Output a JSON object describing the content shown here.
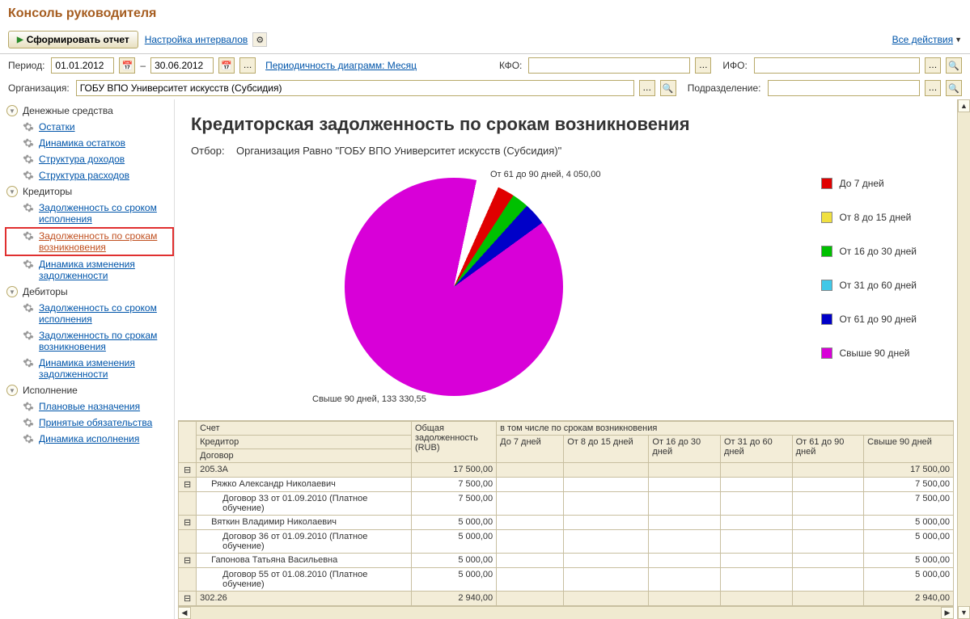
{
  "window_title": "Консоль руководителя",
  "toolbar": {
    "form_report": "Сформировать отчет",
    "interval_settings": "Настройка интервалов",
    "all_actions": "Все действия"
  },
  "filters": {
    "period_label": "Период:",
    "date_from": "01.01.2012",
    "date_to": "30.06.2012",
    "periodicity_link": "Периодичность диаграмм: Месяц",
    "kfo_label": "КФО:",
    "kfo_value": "",
    "ifo_label": "ИФО:",
    "ifo_value": "",
    "org_label": "Организация:",
    "org_value": "ГОБУ ВПО Университет искусств (Субсидия)",
    "dept_label": "Подразделение:",
    "dept_value": ""
  },
  "sidebar": {
    "sections": [
      {
        "title": "Денежные средства",
        "items": [
          "Остатки",
          "Динамика остатков",
          "Структура доходов",
          "Структура расходов"
        ]
      },
      {
        "title": "Кредиторы",
        "items": [
          "Задолженность со сроком исполнения",
          "Задолженность по срокам возникновения",
          "Динамика изменения задолженности"
        ],
        "active_index": 1
      },
      {
        "title": "Дебиторы",
        "items": [
          "Задолженность со сроком исполнения",
          "Задолженность по срокам возникновения",
          "Динамика изменения задолженности"
        ]
      },
      {
        "title": "Исполнение",
        "items": [
          "Плановые назначения",
          "Принятые обязательства",
          "Динамика исполнения"
        ]
      }
    ]
  },
  "report": {
    "title": "Кредиторская задолженность по срокам возникновения",
    "filter_label": "Отбор:",
    "filter_text": "Организация Равно \"ГОБУ ВПО Университет искусств (Субсидия)\"",
    "chart_label_1": "От 61 до 90 дней, 4 050,00",
    "chart_label_2": "Свыше 90 дней, 133 330,55"
  },
  "legend": {
    "items": [
      {
        "label": "До 7 дней",
        "color": "#e00000"
      },
      {
        "label": "От 8 до 15 дней",
        "color": "#f0e040"
      },
      {
        "label": "От 16 до 30 дней",
        "color": "#00c000"
      },
      {
        "label": "От 31 до 60 дней",
        "color": "#40c8e8"
      },
      {
        "label": "От 61 до 90 дней",
        "color": "#0000c8"
      },
      {
        "label": "Свыше 90 дней",
        "color": "#d800d8"
      }
    ]
  },
  "chart_data": {
    "type": "pie",
    "title": "Кредиторская задолженность по срокам возникновения",
    "series": [
      {
        "name": "До 7 дней",
        "value": 2000
      },
      {
        "name": "От 8 до 15 дней",
        "value": 0
      },
      {
        "name": "От 16 до 30 дней",
        "value": 2000
      },
      {
        "name": "От 31 до 60 дней",
        "value": 0
      },
      {
        "name": "От 61 до 90 дней",
        "value": 4050.0
      },
      {
        "name": "Свыше 90 дней",
        "value": 133330.55
      }
    ]
  },
  "table": {
    "headers": {
      "col1_a": "Счет",
      "col1_b": "Кредитор",
      "col1_c": "Договор",
      "col2": "Общая задолженность (RUB)",
      "group": "в том числе по срокам возникновения",
      "sub": [
        "До 7 дней",
        "От 8 до 15 дней",
        "От 16 до 30 дней",
        "От 31 до 60 дней",
        "От 61 до 90 дней",
        "Свыше 90 дней"
      ]
    },
    "rows": [
      {
        "level": 0,
        "name": "205.3А",
        "total": "17 500,00",
        "over90": "17 500,00"
      },
      {
        "level": 1,
        "name": "Ряжко Александр Николаевич",
        "total": "7 500,00",
        "over90": "7 500,00"
      },
      {
        "level": 2,
        "name": "Договор 33 от 01.09.2010 (Платное обучение)",
        "total": "7 500,00",
        "over90": "7 500,00"
      },
      {
        "level": 1,
        "name": "Вяткин Владимир Николаевич",
        "total": "5 000,00",
        "over90": "5 000,00"
      },
      {
        "level": 2,
        "name": "Договор 36 от 01.09.2010 (Платное обучение)",
        "total": "5 000,00",
        "over90": "5 000,00"
      },
      {
        "level": 1,
        "name": "Гапонова Татьяна Васильевна",
        "total": "5 000,00",
        "over90": "5 000,00"
      },
      {
        "level": 2,
        "name": "Договор 55 от 01.08.2010 (Платное обучение)",
        "total": "5 000,00",
        "over90": "5 000,00"
      },
      {
        "level": 0,
        "name": "302.26",
        "total": "2 940,00",
        "over90": "2 940,00"
      }
    ]
  }
}
